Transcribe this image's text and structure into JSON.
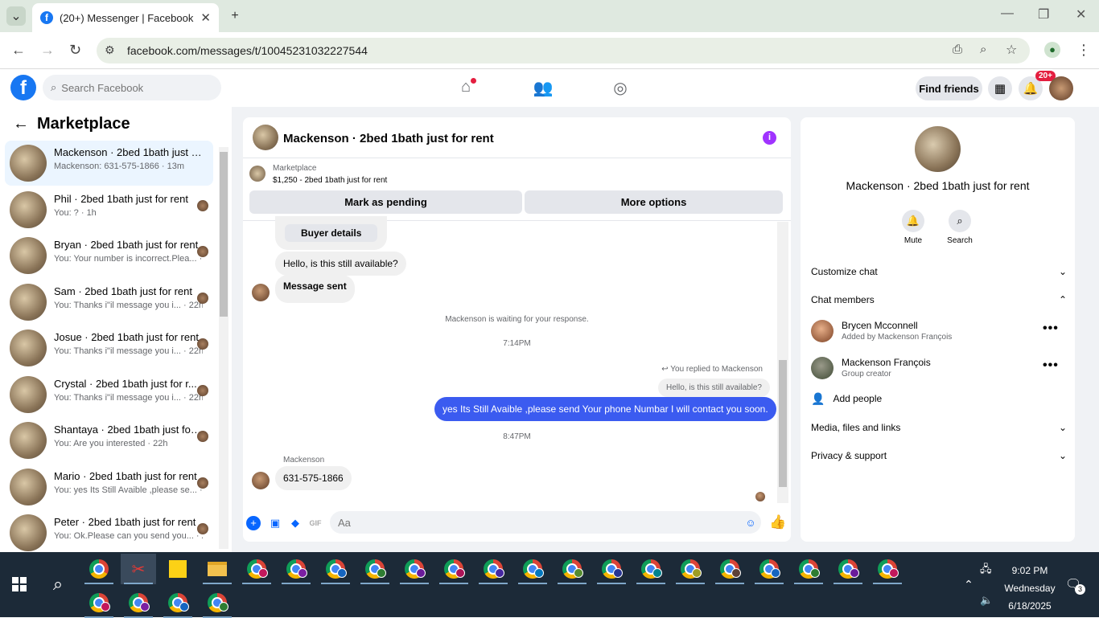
{
  "browser": {
    "tab_title": "(20+) Messenger | Facebook",
    "url": "facebook.com/messages/t/10045231032227544"
  },
  "fb": {
    "search_placeholder": "Search Facebook",
    "find_friends": "Find friends",
    "notif_badge": "20+"
  },
  "left": {
    "title": "Marketplace",
    "conversations": [
      {
        "name": "Mackenson · 2bed 1bath just fo...",
        "preview": "Mackenson: 631-575-1866 · 13m",
        "active": true
      },
      {
        "name": "Phil · 2bed 1bath just for rent",
        "preview": "You: ? · 1h"
      },
      {
        "name": "Bryan · 2bed 1bath just for rent",
        "preview": "You: Your number is incorrect.Plea... · 1h"
      },
      {
        "name": "Sam · 2bed 1bath just for rent",
        "preview": "You: Thanks i\"il message you i... · 22h"
      },
      {
        "name": "Josue · 2bed 1bath just for rent",
        "preview": "You: Thanks i\"il message you i... · 22h"
      },
      {
        "name": "Crystal · 2bed 1bath just for r...",
        "preview": "You: Thanks i\"il message you i... · 22h"
      },
      {
        "name": "Shantaya · 2bed 1bath just for r...",
        "preview": "You: Are you interested · 22h"
      },
      {
        "name": "Mario · 2bed 1bath just for rent",
        "preview": "You: yes Its Still Avaible ,please se... · 22h"
      },
      {
        "name": "Peter · 2bed 1bath just for rent",
        "preview": "You: Ok.Please can you send you... · 22h"
      }
    ]
  },
  "chat": {
    "title": "Mackenson · 2bed 1bath just for rent",
    "marketplace_label": "Marketplace",
    "listing": "$1,250 - 2bed 1bath just for rent",
    "mark_pending": "Mark as pending",
    "more_options": "More options",
    "buyer_details": "Buyer details",
    "msg_available": "Hello, is this still available?",
    "msg_sent": "Message sent",
    "waiting": "Mackenson is waiting for your response.",
    "time1": "7:14PM",
    "replied_to": "You replied to Mackenson",
    "quoted": "Hello, is this still available?",
    "my_message": "yes Its Still Avaible ,please send Your phone Numbar I will contact you soon.",
    "time2": "8:47PM",
    "sender": "Mackenson",
    "phone_message": "631-575-1866",
    "input_placeholder": "Aa"
  },
  "right": {
    "name": "Mackenson · 2bed 1bath just for rent",
    "mute": "Mute",
    "search": "Search",
    "customize_chat": "Customize chat",
    "chat_members": "Chat members",
    "members": [
      {
        "name": "Brycen Mcconnell",
        "sub": "Added by Mackenson François"
      },
      {
        "name": "Mackenson François",
        "sub": "Group creator"
      }
    ],
    "add_people": "Add people",
    "media": "Media, files and links",
    "privacy": "Privacy & support"
  },
  "taskbar": {
    "time": "9:02 PM",
    "day": "Wednesday",
    "date": "6/18/2025",
    "notif_count": "3"
  },
  "colors": {
    "fb_blue": "#1877f2",
    "messenger_blue": "#0866ff",
    "my_bubble": "#3b5bf0",
    "info_purple": "#a033ff",
    "badge_red": "#e41e3f"
  }
}
